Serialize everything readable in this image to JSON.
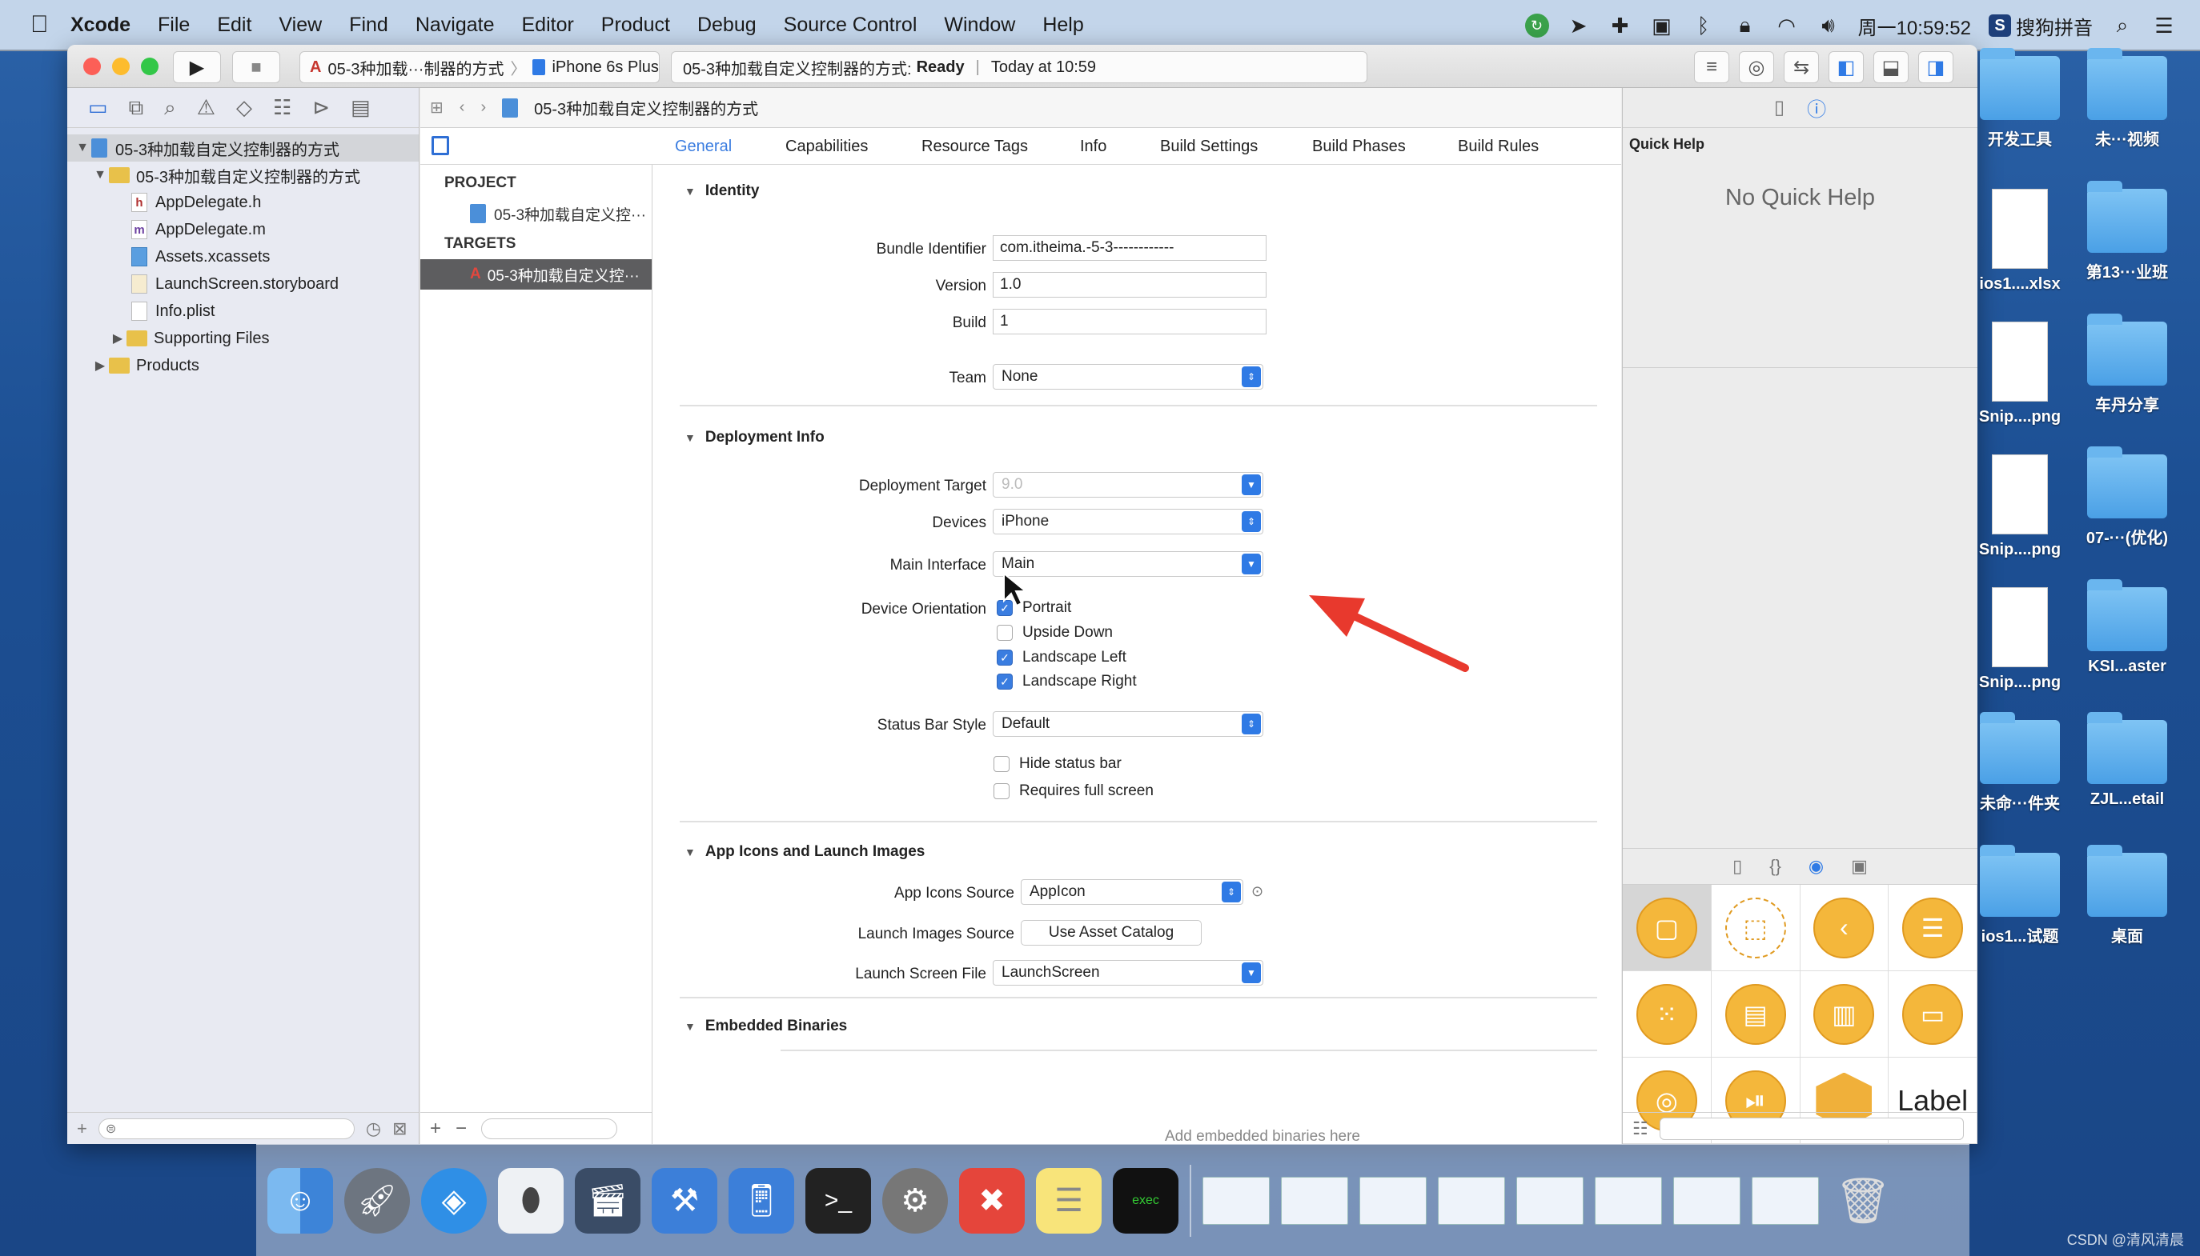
{
  "menubar": {
    "app": "Xcode",
    "items": [
      "File",
      "Edit",
      "View",
      "Find",
      "Navigate",
      "Editor",
      "Product",
      "Debug",
      "Source Control",
      "Window",
      "Help"
    ],
    "clock": "周一10:59:52",
    "ime": "搜狗拼音"
  },
  "toolbar": {
    "scheme": "05-3种加载···制器的方式",
    "device": "iPhone 6s Plus",
    "activity_project": "05-3种加载自定义控制器的方式:",
    "activity_status": "Ready",
    "activity_time": "Today at 10:59"
  },
  "navigator": {
    "items": [
      {
        "label": "05-3种加载自定义控制器的方式",
        "type": "project",
        "expanded": true
      },
      {
        "label": "05-3种加载自定义控制器的方式",
        "type": "folder",
        "expanded": true
      },
      {
        "label": "AppDelegate.h",
        "type": "h"
      },
      {
        "label": "AppDelegate.m",
        "type": "m"
      },
      {
        "label": "Assets.xcassets",
        "type": "assets"
      },
      {
        "label": "LaunchScreen.storyboard",
        "type": "storyboard"
      },
      {
        "label": "Info.plist",
        "type": "plist"
      },
      {
        "label": "Supporting Files",
        "type": "folder",
        "expanded": false
      },
      {
        "label": "Products",
        "type": "folder",
        "expanded": false
      }
    ]
  },
  "jumpbar": {
    "path": "05-3种加载自定义控制器的方式"
  },
  "tabs": [
    "General",
    "Capabilities",
    "Resource Tags",
    "Info",
    "Build Settings",
    "Build Phases",
    "Build Rules"
  ],
  "active_tab": "General",
  "targets_panel": {
    "project_header": "PROJECT",
    "project_item": "05-3种加载自定义控···",
    "targets_header": "TARGETS",
    "target_item": "05-3种加载自定义控···"
  },
  "identity": {
    "title": "Identity",
    "bundle_id_label": "Bundle Identifier",
    "bundle_id": "com.itheima.-5-3------------",
    "version_label": "Version",
    "version": "1.0",
    "build_label": "Build",
    "build": "1",
    "team_label": "Team",
    "team": "None"
  },
  "deployment": {
    "title": "Deployment Info",
    "target_label": "Deployment Target",
    "target": "9.0",
    "devices_label": "Devices",
    "devices": "iPhone",
    "main_interface_label": "Main Interface",
    "main_interface": "Main",
    "orientation_label": "Device Orientation",
    "orientations": [
      {
        "label": "Portrait",
        "checked": true
      },
      {
        "label": "Upside Down",
        "checked": false
      },
      {
        "label": "Landscape Left",
        "checked": true
      },
      {
        "label": "Landscape Right",
        "checked": true
      }
    ],
    "status_bar_label": "Status Bar Style",
    "status_bar": "Default",
    "hide_status_bar": {
      "label": "Hide status bar",
      "checked": false
    },
    "requires_full_screen": {
      "label": "Requires full screen",
      "checked": false
    }
  },
  "app_icons": {
    "title": "App Icons and Launch Images",
    "icons_source_label": "App Icons Source",
    "icons_source": "AppIcon",
    "launch_images_label": "Launch Images Source",
    "launch_images_button": "Use Asset Catalog",
    "launch_screen_label": "Launch Screen File",
    "launch_screen": "LaunchScreen"
  },
  "embedded": {
    "title": "Embedded Binaries",
    "hint": "Add embedded binaries here"
  },
  "inspector": {
    "quick_help_title": "Quick Help",
    "no_quick_help": "No Quick Help",
    "library_label": "Label"
  },
  "desktop": [
    {
      "label": "开发工具",
      "kind": "folder"
    },
    {
      "label": "未···视频",
      "kind": "folder"
    },
    {
      "label": "ios1....xlsx",
      "kind": "xlsx"
    },
    {
      "label": "第13···业班",
      "kind": "folder"
    },
    {
      "label": "Snip....png",
      "kind": "png"
    },
    {
      "label": "车丹分享",
      "kind": "folder"
    },
    {
      "label": "Snip....png",
      "kind": "png"
    },
    {
      "label": "07-···(优化)",
      "kind": "folder"
    },
    {
      "label": "Snip....png",
      "kind": "png"
    },
    {
      "label": "KSI...aster",
      "kind": "folder"
    },
    {
      "label": "未命···件夹",
      "kind": "folder"
    },
    {
      "label": "ZJL...etail",
      "kind": "folder"
    },
    {
      "label": "ios1...试题",
      "kind": "folder"
    },
    {
      "label": "桌面",
      "kind": "folder"
    }
  ],
  "watermark": "CSDN @清风清晨"
}
